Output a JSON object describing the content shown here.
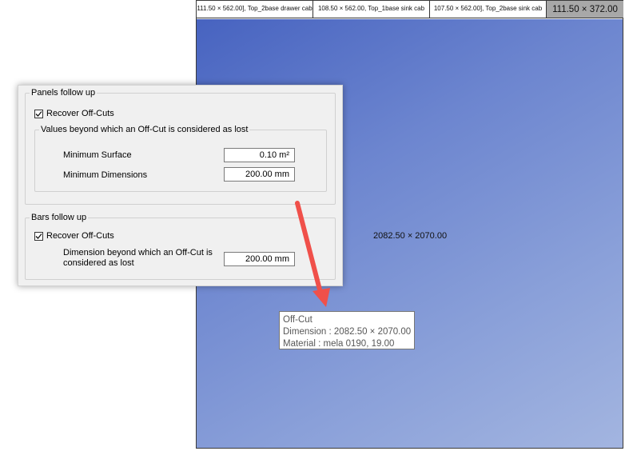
{
  "strips": [
    {
      "label": "111.50 × 562.00], Top_2base drawer cab"
    },
    {
      "label": "108.50 × 562.00, Top_1base sink cab"
    },
    {
      "label": "107.50 × 562.00], Top_2base sink cab"
    },
    {
      "label": "111.50 × 372.00"
    }
  ],
  "offcut": {
    "label": "2082.50 × 2070.00"
  },
  "tooltip": {
    "title": "Off-Cut",
    "dimension": "Dimension : 2082.50 × 2070.00",
    "material": "Material : mela 0190, 19.00"
  },
  "panels": {
    "legend": "Panels follow up",
    "recover_label": "Recover Off-Cuts",
    "recover_checked": true,
    "values_legend": "Values beyond which an Off-Cut is considered as lost",
    "min_surface_label": "Minimum Surface",
    "min_surface_value": "0.10 m²",
    "min_dim_label": "Minimum Dimensions",
    "min_dim_value": "200.00 mm"
  },
  "bars": {
    "legend": "Bars follow up",
    "recover_label": "Recover Off-Cuts",
    "recover_checked": true,
    "dim_label_line1": "Dimension beyond which an Off-Cut is",
    "dim_label_line2": "considered as lost",
    "dim_value": "200.00 mm"
  },
  "colors": {
    "arrow": "#f0504a",
    "offcut_start": "#4763c0",
    "offcut_end": "#a3b5e0"
  }
}
